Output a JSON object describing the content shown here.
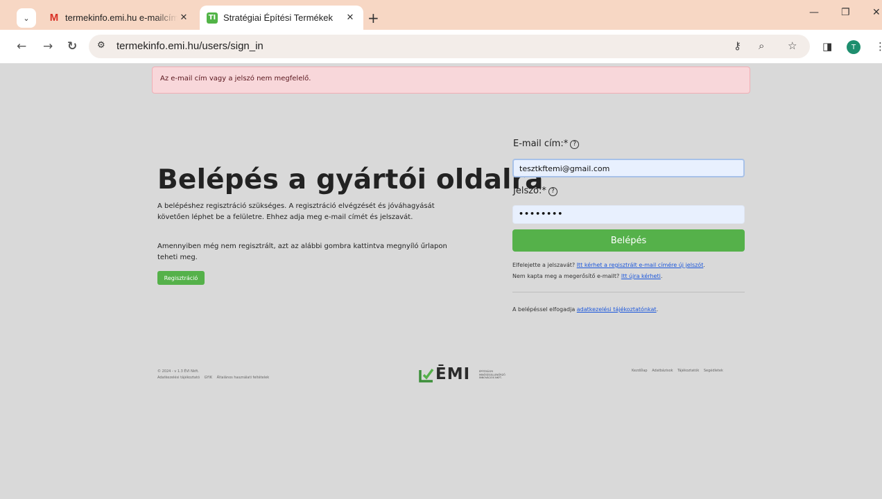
{
  "browser": {
    "tabs": [
      {
        "title": "termekinfo.emi.hu e-mailcím m",
        "favicon": "gmail-icon",
        "active": false
      },
      {
        "title": "Stratégiai Építési Termékek",
        "favicon": "TI",
        "active": true
      }
    ],
    "url": "termekinfo.emi.hu/users/sign_in",
    "profile_initial": "T"
  },
  "alert": {
    "message": "Az e-mail cím vagy a jelszó nem megfelelő."
  },
  "hero": {
    "title": "Belépés a gyártói oldalra",
    "paragraph1": "A belépéshez regisztráció szükséges. A regisztráció elvégzését és jóváhagyását követően léphet be a felületre. Ehhez adja meg e-mail címét és jelszavát.",
    "paragraph2": "Amennyiben még nem regisztrált, azt az alábbi gombra kattintva megnyíló űrlapon teheti meg.",
    "register_label": "Regisztráció"
  },
  "form": {
    "email_label": "E-mail cím:*",
    "email_value": "tesztkftemi@gmail.com",
    "password_label": "Jelszó:*",
    "password_value": "••••••••",
    "submit_label": "Belépés",
    "forgot_prefix": "Elfelejette a jelszavát? ",
    "forgot_link": "Itt kérhet a regisztrált e-mail címére új jelszót",
    "forgot_suffix": ".",
    "confirm_prefix": "Nem kapta meg a megerősítő e-mailt? ",
    "confirm_link": "Itt újra kérheti",
    "confirm_suffix": ".",
    "privacy_prefix": "A belépéssel elfogadja ",
    "privacy_link": "adatkezelési tájékoztatónkat",
    "privacy_suffix": "."
  },
  "footer": {
    "copyright": "© 2024 - v 1.3 ÉVI Nkft.",
    "links_left": [
      "Adatkezelési tájékoztató",
      "GYIK",
      "Általános használati feltételek"
    ],
    "logo_text": "ĒMI",
    "logo_sub": [
      "ÉPÍTÉSÜGYI",
      "MINŐSÉGELLENŐRZŐ",
      "INNOVÁCIÓS NKFT."
    ],
    "links_right": [
      "Kezdőlap",
      "Adatbázisok",
      "Tájékoztatók",
      "Segédletek"
    ]
  },
  "colors": {
    "accent_green": "#55b14a",
    "alert_bg": "#f8d7da",
    "link": "#1a56db"
  }
}
